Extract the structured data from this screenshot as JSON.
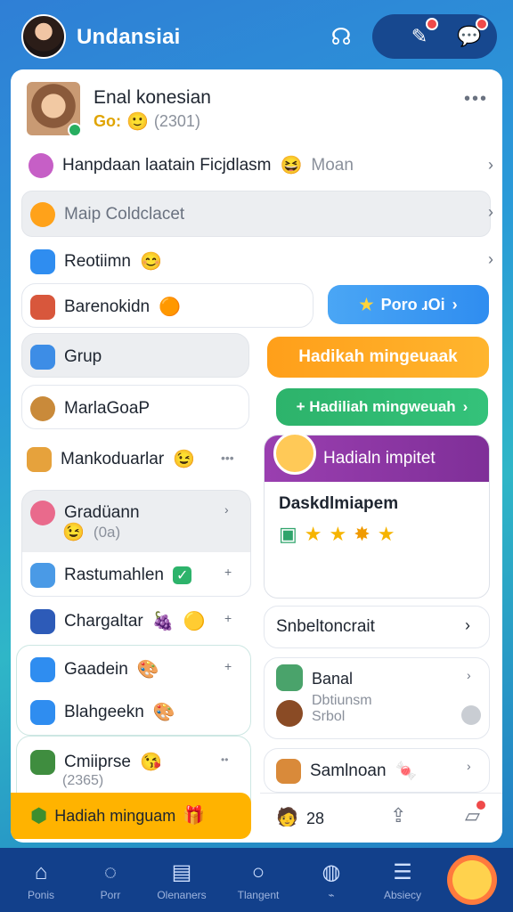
{
  "header": {
    "title": "Undansiai"
  },
  "profile": {
    "name": "Enal konesian",
    "status": "Go:",
    "count": "(2301)"
  },
  "rows": {
    "row1": {
      "label": "Hanpdaan laatain Ficjdlasm",
      "trailing": "Moan"
    },
    "row2": {
      "label": "Maip Coldclacet"
    },
    "row3": {
      "label": "Reotiimn"
    },
    "row4": {
      "label": "Barenokidn",
      "button": "Poro ɹOi"
    },
    "grup": {
      "label": "Grup"
    },
    "hadiah_orange": {
      "label": "Hadikah mingeuaak"
    },
    "marla": {
      "label": "MarlaGoaP"
    },
    "hadiah_green": {
      "label": "+ Hadiliah mingweuah"
    },
    "manko": {
      "label": "Mankoduarlar"
    },
    "purple": {
      "header": "Hadialn impitet",
      "title": "Daskdlmiapem"
    },
    "grad": {
      "label": "Gradüann",
      "sub": "(0a)"
    },
    "rast": {
      "label": "Rastumahlen"
    },
    "charg": {
      "label": "Chargaltar"
    },
    "snbel": {
      "label": "Snbeltoncrait"
    },
    "gaad": {
      "label": "Gaadein"
    },
    "blah": {
      "label": "Blahgeekn"
    },
    "banal": {
      "label": "Banal",
      "sub1": "Dbtiunsm",
      "sub2": "Srbol"
    },
    "cmi": {
      "label": "Cmiiprse",
      "sub": "(2365)"
    },
    "sam": {
      "label": "Samlnoan"
    },
    "hadiah_yellow": {
      "label": "Hadiah minguam"
    },
    "mini_count": "28"
  },
  "nav": [
    {
      "label": "Ponis"
    },
    {
      "label": "Porr"
    },
    {
      "label": "Olenaners"
    },
    {
      "label": "Tlangent"
    },
    {
      "label": "⌁"
    },
    {
      "label": "Absiecy"
    }
  ],
  "colors": {
    "accent": "#2f8df0",
    "orange": "#ff9f1a",
    "green": "#2db36b",
    "purple": "#8e3aa6"
  }
}
